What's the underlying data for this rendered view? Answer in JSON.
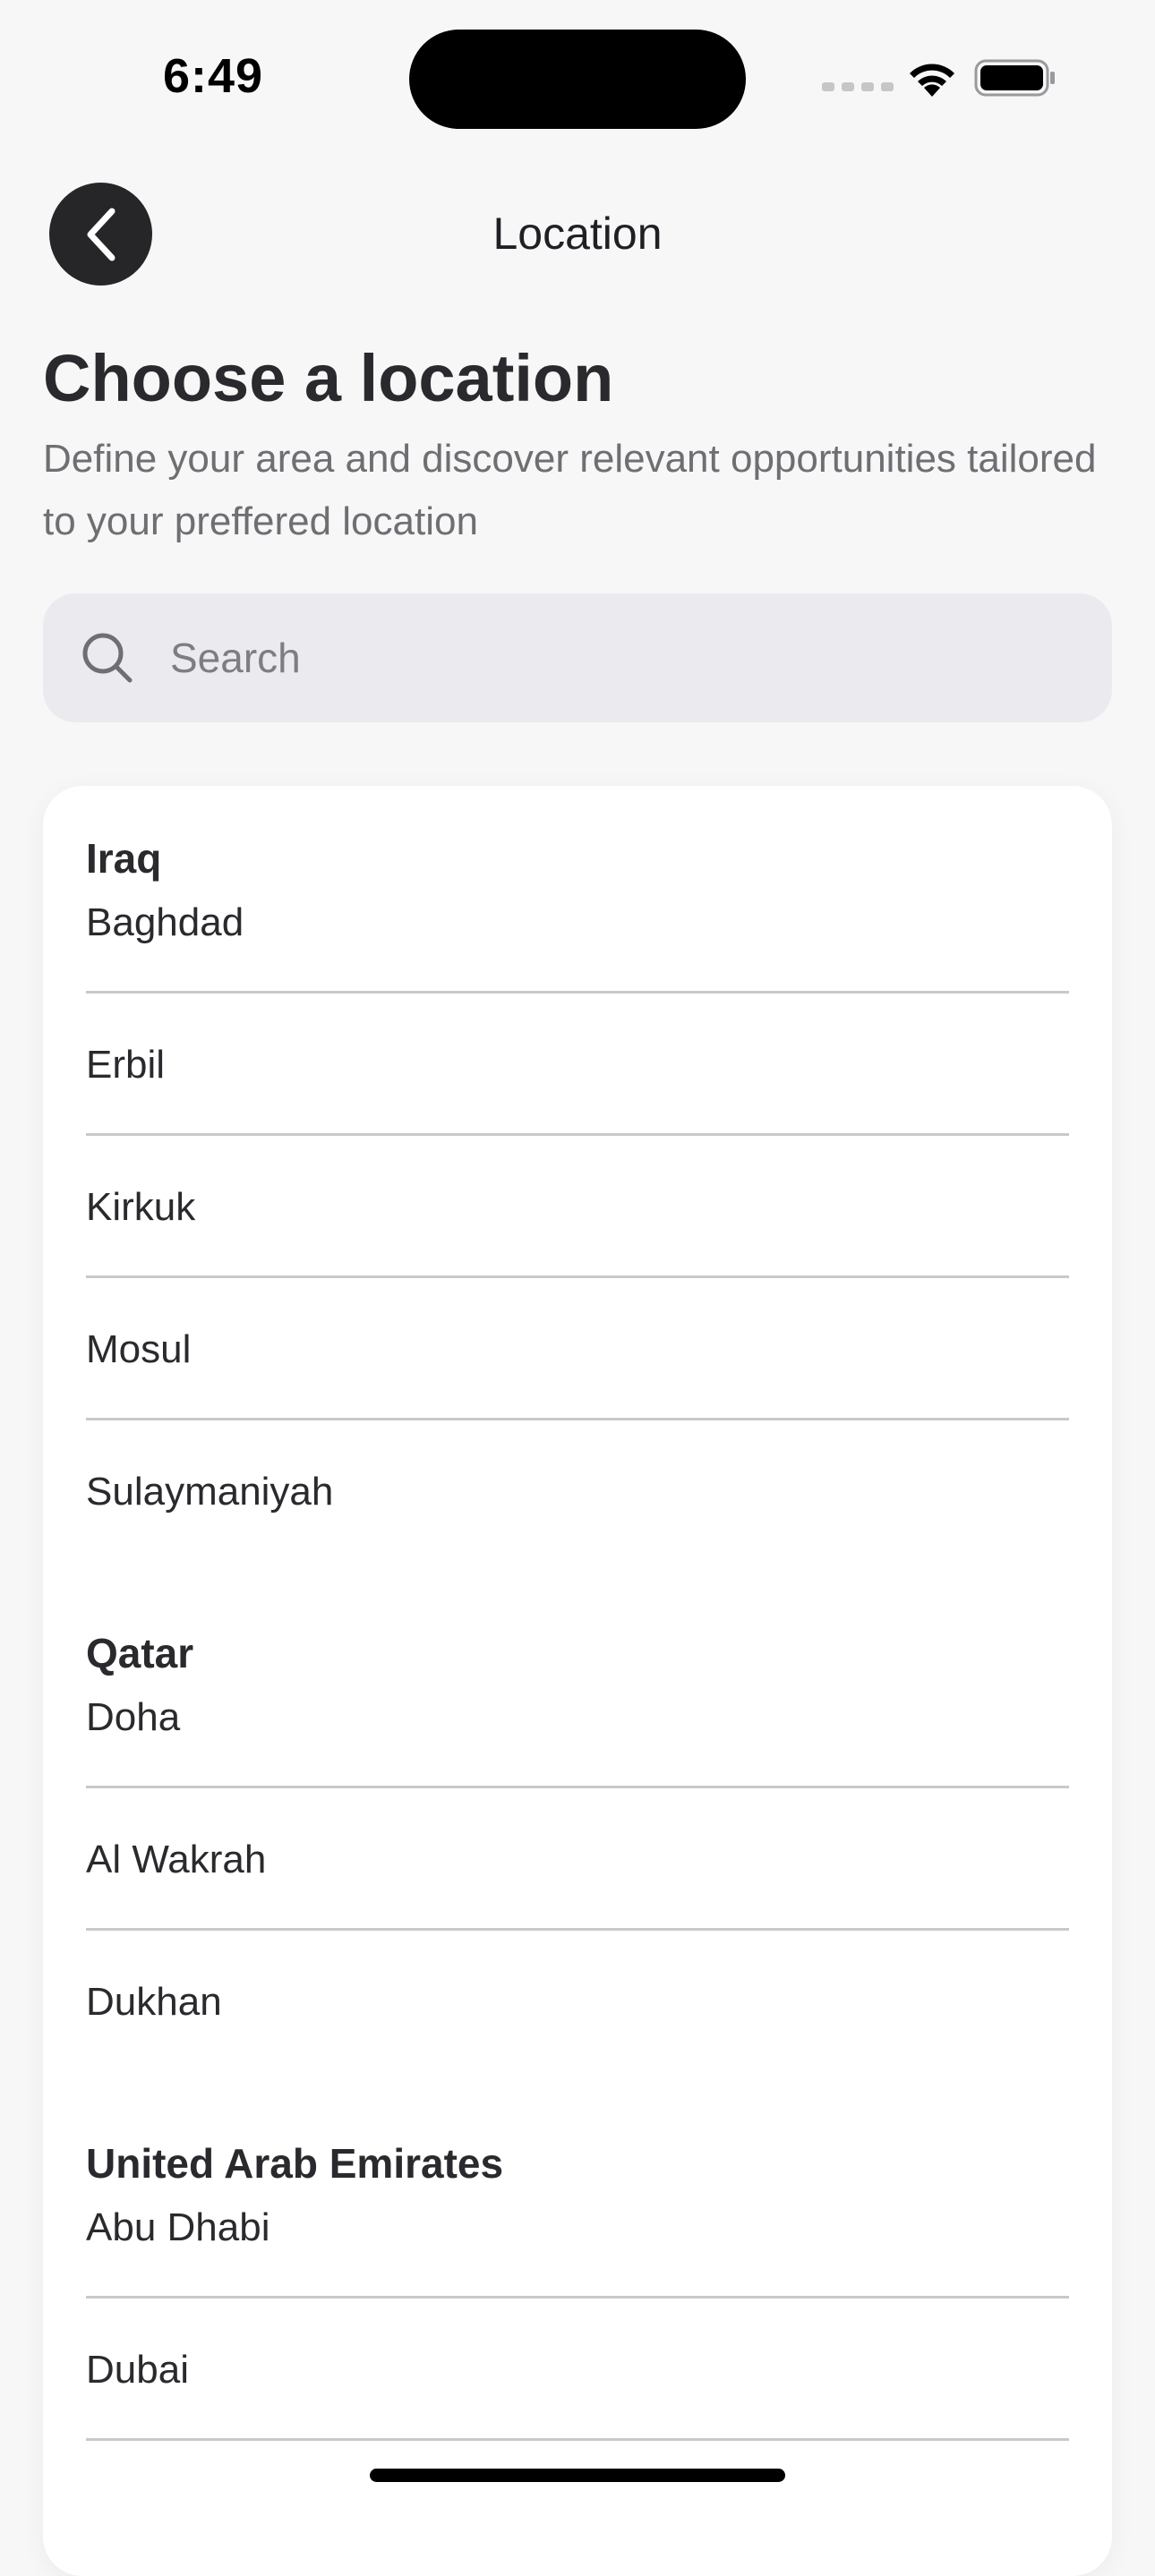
{
  "status_bar": {
    "time": "6:49"
  },
  "nav": {
    "title": "Location"
  },
  "header": {
    "title": "Choose a location",
    "subtitle": "Define your area and discover relevant opportunities tailored to your preffered location"
  },
  "search": {
    "placeholder": "Search",
    "value": ""
  },
  "groups": [
    {
      "country": "Iraq",
      "cities": [
        "Baghdad",
        "Erbil",
        "Kirkuk",
        "Mosul",
        "Sulaymaniyah"
      ]
    },
    {
      "country": "Qatar",
      "cities": [
        "Doha",
        "Al Wakrah",
        "Dukhan"
      ]
    },
    {
      "country": "United Arab Emirates",
      "cities": [
        "Abu Dhabi",
        "Dubai"
      ]
    }
  ],
  "colors": {
    "background": "#f7f7f8",
    "back_button": "#262628",
    "search_bg": "#ebebef",
    "divider": "#c9c9cc",
    "subtitle": "#6e6e73"
  }
}
